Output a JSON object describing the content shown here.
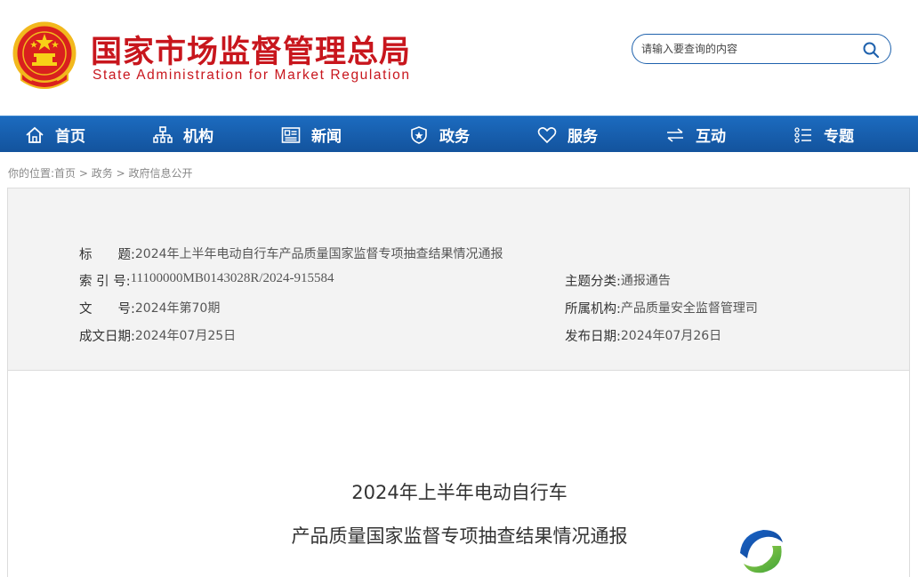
{
  "header": {
    "brand_cn": "国家市场监督管理总局",
    "brand_en": "State Administration for Market Regulation",
    "search_placeholder": "请输入要查询的内容"
  },
  "nav": {
    "items": [
      {
        "label": "首页",
        "icon": "home-icon"
      },
      {
        "label": "机构",
        "icon": "org-chart-icon"
      },
      {
        "label": "新闻",
        "icon": "news-icon"
      },
      {
        "label": "政务",
        "icon": "shield-icon"
      },
      {
        "label": "服务",
        "icon": "heart-icon"
      },
      {
        "label": "互动",
        "icon": "exchange-arrows-icon"
      },
      {
        "label": "专题",
        "icon": "list-icon"
      }
    ]
  },
  "breadcrumb": {
    "prefix": "你的位置:",
    "items": [
      "首页",
      "政务",
      "政府信息公开"
    ],
    "separator": " > "
  },
  "info": {
    "title_label": "标　　题:",
    "title_value": "2024年上半年电动自行车产品质量国家监督专项抽查结果情况通报",
    "index_label": "索 引 号:",
    "index_value": "11100000MB0143028R/2024-915584",
    "category_label": "主题分类:",
    "category_value": "通报通告",
    "doc_no_label": "文　　号:",
    "doc_no_value": "2024年第70期",
    "org_label": "所属机构:",
    "org_value": "产品质量安全监督管理司",
    "created_label": "成文日期:",
    "created_value": "2024年07月25日",
    "published_label": "发布日期:",
    "published_value": "2024年07月26日"
  },
  "article": {
    "title_line1": "2024年上半年电动自行车",
    "title_line2": "产品质量国家监督专项抽查结果情况通报"
  },
  "colors": {
    "brand_red": "#c8161d",
    "nav_blue": "#1a62b3",
    "search_border": "#1f62ad"
  }
}
